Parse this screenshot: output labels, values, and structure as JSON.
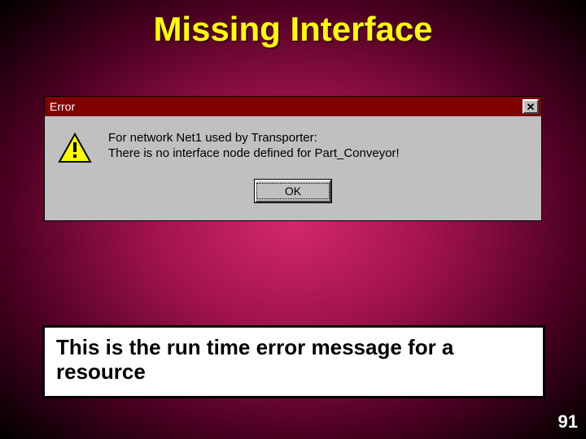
{
  "slide": {
    "title": "Missing Interface",
    "caption": "This is the run time error message for a resource",
    "page_number": "91"
  },
  "dialog": {
    "title": "Error",
    "close_symbol": "✕",
    "icon": "warning-icon",
    "message_line1": "For network Net1 used by Transporter:",
    "message_line2": "There is no interface node defined for Part_Conveyor!",
    "ok_label": "OK"
  }
}
